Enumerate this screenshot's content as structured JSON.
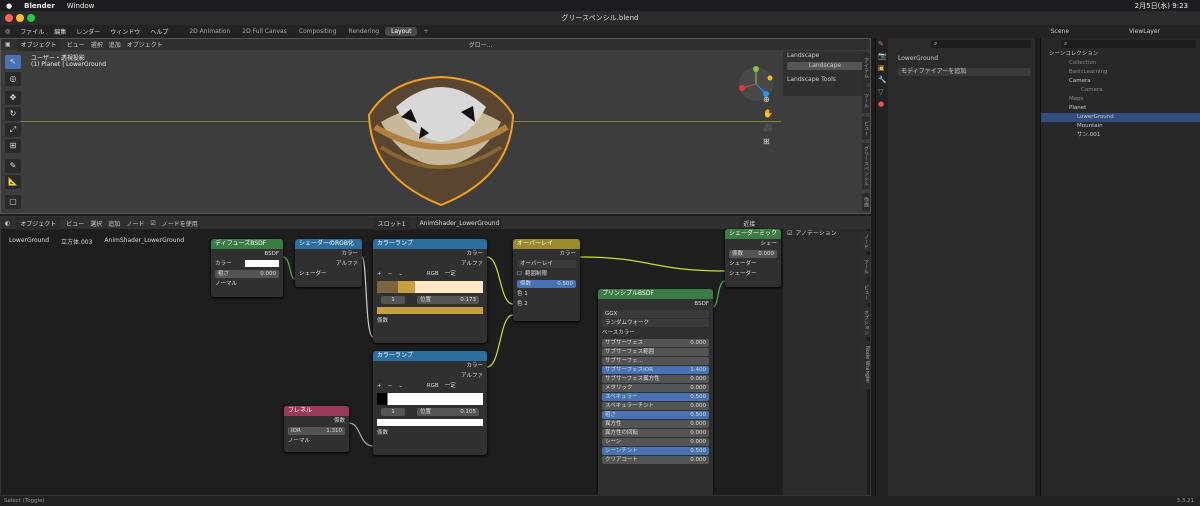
{
  "mac": {
    "apple": "",
    "app": "Blender",
    "window": "Window",
    "right": "2月5日(水) 9:23"
  },
  "title": "グリースペンシル.blend",
  "menu": [
    "ファイル",
    "編集",
    "レンダー",
    "ウィンドウ",
    "ヘルプ"
  ],
  "workspaces": [
    "2D Animation",
    "2D Full Canvas",
    "Compositing",
    "Rendering",
    "Layout"
  ],
  "scene": "Scene",
  "viewlayer": "ViewLayer",
  "viewport": {
    "mode": "オブジェクト",
    "menus": [
      "ビュー",
      "選択",
      "追加",
      "オブジェクト"
    ],
    "view_label": "ユーザー・透視投影",
    "object_label": "(1) Planet | LowerGround",
    "orient": "グロー...",
    "panel": {
      "landscape_hdr": "Landscape",
      "landscape_btn": "Landscape",
      "tools_hdr": "Landscape Tools"
    },
    "tabs": [
      "アイテム",
      "ツール",
      "ビュー",
      "グリースペンシル",
      "作成"
    ]
  },
  "nodeeditor": {
    "mode": "オブジェクト",
    "menus": [
      "ビュー",
      "選択",
      "追加",
      "ノード"
    ],
    "use_nodes": "ノードを使用",
    "slot": "スロット1",
    "material": "AnimShader_LowerGround",
    "near": "近接",
    "breadcrumb": [
      "LowerGround",
      "立方体.003",
      "AnimShader_LowerGround"
    ],
    "sidepanel": {
      "annotation": "アノテーション"
    },
    "tabs": [
      "ノード",
      "ツール",
      "ビュー",
      "オプション",
      "Node Wrangler"
    ]
  },
  "nodes": {
    "diffuse": {
      "title": "ディフューズBSDF",
      "out": "BSDF",
      "color": "カラー",
      "rough": "粗さ",
      "rough_val": "0.000",
      "normal": "ノーマル"
    },
    "s2rgb": {
      "title": "シェーダーのRGB化",
      "color": "カラー",
      "alpha": "アルファ",
      "shader": "シェーダー"
    },
    "ramp1": {
      "title": "カラーランプ",
      "color": "カラー",
      "alpha": "アルファ",
      "mode": "RGB",
      "interp": "一定",
      "idx": "1",
      "pos": "位置",
      "pos_val": "0.173",
      "fac": "係数"
    },
    "overlay": {
      "title": "オーバーレイ",
      "out": "カラー",
      "mode": "オーバーレイ",
      "clamp": "範囲制限",
      "fac": "係数",
      "fac_val": "0.500",
      "c1": "色 1",
      "c2": "色 2"
    },
    "mix": {
      "title": "シェーダーミック",
      "out": "シェー",
      "fac": "係数",
      "fac_val": "0.000",
      "s1": "シェーダー",
      "s2": "シェーダー"
    },
    "ramp2": {
      "title": "カラーランプ",
      "color": "カラー",
      "alpha": "アルファ",
      "mode": "RGB",
      "interp": "一定",
      "idx": "1",
      "pos": "位置",
      "pos_val": "0.105",
      "fac": "係数"
    },
    "fresnel": {
      "title": "フレネル",
      "out": "係数",
      "ior": "IOR",
      "ior_val": "1.310",
      "normal": "ノーマル"
    },
    "principled": {
      "title": "プリンシプルBSDF",
      "out": "BSDF",
      "dist": "GGX",
      "sss_method": "ランダムウォーク",
      "base": "ベースカラー",
      "rows": [
        [
          "サブサーフェス",
          "0.000"
        ],
        [
          "サブサーフェス範囲",
          ""
        ],
        [
          "サブサーフェ...",
          ""
        ],
        [
          "サブサーフェスIOR",
          "1.400"
        ],
        [
          "サブサーフェス異方性",
          "0.000"
        ],
        [
          "メタリック",
          "0.000"
        ],
        [
          "スペキュラー",
          "0.500"
        ],
        [
          "スペキュラーチント",
          "0.000"
        ],
        [
          "粗さ",
          "0.500"
        ],
        [
          "異方性",
          "0.000"
        ],
        [
          "異方性の回転",
          "0.000"
        ],
        [
          "シーン",
          "0.000"
        ],
        [
          "シーンチント",
          "0.500"
        ],
        [
          "クリアコート",
          "0.000"
        ]
      ]
    }
  },
  "props": {
    "object": "LowerGround",
    "add_modifier": "モディファイアーを追加"
  },
  "outliner": {
    "root": "シーンコレクション",
    "items": [
      "Collection",
      "BasicLearning",
      "Camera",
      "Camera",
      "Maps",
      "Planet",
      "LowerGround",
      "Mountain",
      "サン.001"
    ]
  },
  "status": {
    "left": "Select (Toggle)",
    "right": "3.3.21"
  }
}
